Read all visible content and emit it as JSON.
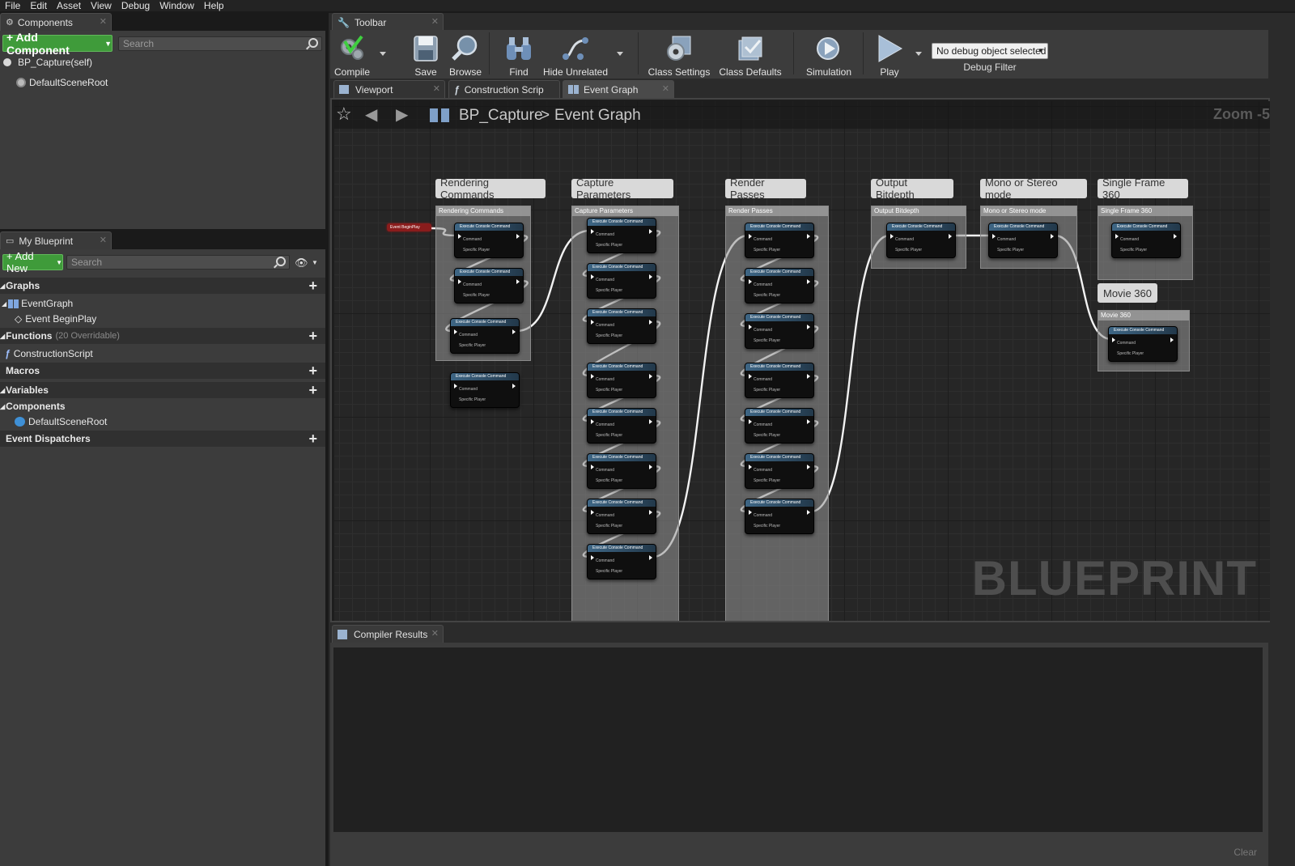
{
  "menubar": [
    "File",
    "Edit",
    "Asset",
    "View",
    "Debug",
    "Window",
    "Help"
  ],
  "components_panel": {
    "tab_label": "Components",
    "add_button": "+ Add Component",
    "search_placeholder": "Search",
    "self_item": "BP_Capture(self)",
    "root_item": "DefaultSceneRoot"
  },
  "my_blueprint": {
    "tab_label": "My Blueprint",
    "add_button": "+ Add New",
    "search_placeholder": "Search",
    "graphs_label": "Graphs",
    "eventgraph_label": "EventGraph",
    "event_beginplay": "Event BeginPlay",
    "functions_label": "Functions",
    "functions_count": "(20 Overridable)",
    "construction_script": "ConstructionScript",
    "macros_label": "Macros",
    "variables_label": "Variables",
    "components_label": "Components",
    "default_scene_root": "DefaultSceneRoot",
    "event_dispatchers_label": "Event Dispatchers"
  },
  "toolbar": {
    "tab_label": "Toolbar",
    "compile": "Compile",
    "save": "Save",
    "browse": "Browse",
    "find": "Find",
    "hide_unrelated": "Hide Unrelated",
    "class_settings": "Class Settings",
    "class_defaults": "Class Defaults",
    "simulation": "Simulation",
    "play": "Play",
    "debug_select": "No debug object selected",
    "debug_filter": "Debug Filter"
  },
  "editor_tabs": {
    "viewport": "Viewport",
    "construction": "Construction Scrip",
    "event_graph": "Event Graph"
  },
  "graph": {
    "breadcrumb_root": "BP_Capture",
    "breadcrumb_sep": ">",
    "breadcrumb_current": "Event Graph",
    "zoom": "Zoom -5",
    "watermark": "BLUEPRINT",
    "event_node": "Event BeginPlay",
    "node_header": "Execute Console Command",
    "node_pin_command": "Command",
    "node_pin_player": "Specific Player",
    "comments": [
      {
        "label": "Rendering Commands"
      },
      {
        "label": "Capture Parameters"
      },
      {
        "label": "Render Passes"
      },
      {
        "label": "Output Bitdepth"
      },
      {
        "label": "Mono or Stereo mode"
      },
      {
        "label": "Single Frame 360"
      },
      {
        "label": "Movie 360"
      }
    ]
  },
  "compiler": {
    "tab_label": "Compiler Results",
    "clear_button": "Clear"
  }
}
